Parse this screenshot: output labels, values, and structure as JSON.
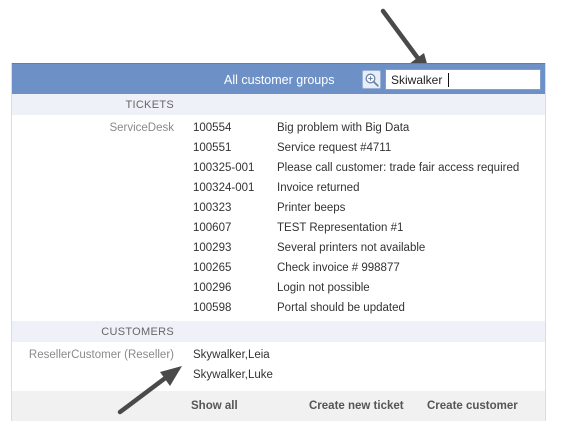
{
  "header": {
    "scope_label": "All customer groups",
    "search_value": "Skiwalker",
    "search_icon": "zoom-in-magnifier-icon",
    "bg_color": "#6d91c7"
  },
  "tickets": {
    "heading": "TICKETS",
    "group_label": "ServiceDesk",
    "rows": [
      {
        "id": "100554",
        "title": "Big problem with Big Data"
      },
      {
        "id": "100551",
        "title": "Service request #4711"
      },
      {
        "id": "100325-001",
        "title": "Please call customer: trade fair access required"
      },
      {
        "id": "100324-001",
        "title": "Invoice returned"
      },
      {
        "id": "100323",
        "title": "Printer beeps"
      },
      {
        "id": "100607",
        "title": "TEST Representation #1"
      },
      {
        "id": "100293",
        "title": "Several printers not available"
      },
      {
        "id": "100265",
        "title": "Check invoice # 998877"
      },
      {
        "id": "100296",
        "title": "Login not possible"
      },
      {
        "id": "100598",
        "title": "Portal should be updated"
      }
    ]
  },
  "customers": {
    "heading": "CUSTOMERS",
    "group_label": "ResellerCustomer (Reseller)",
    "items": [
      "Skywalker,Leia",
      "Skywalker,Luke"
    ]
  },
  "footer": {
    "show_all": "Show all",
    "create_ticket": "Create new ticket",
    "create_customer": "Create customer"
  }
}
